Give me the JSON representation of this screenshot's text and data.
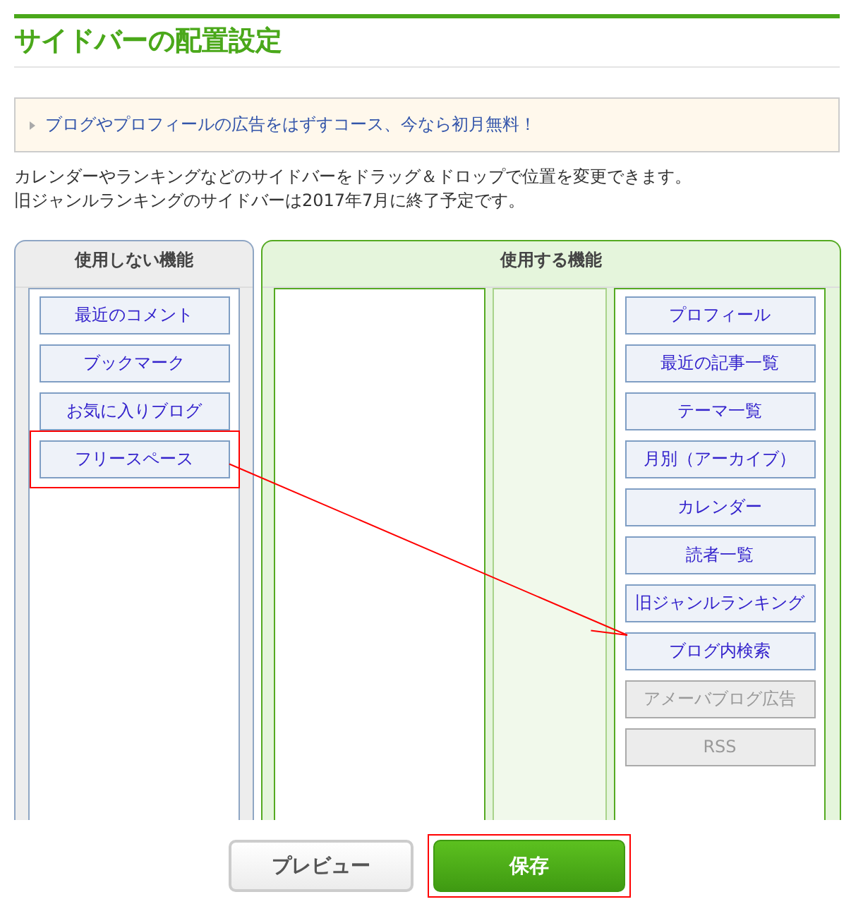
{
  "title": "サイドバーの配置設定",
  "notice": {
    "text": "ブログやプロフィールの広告をはずすコース、今なら初月無料！"
  },
  "description": [
    "カレンダーやランキングなどのサイドバーをドラッグ＆ドロップで位置を変更できます。",
    "旧ジャンルランキングのサイドバーは2017年7月に終了予定です。"
  ],
  "unused": {
    "heading": "使用しない機能",
    "items": [
      {
        "label": "最近のコメント",
        "disabled": false,
        "highlighted": false
      },
      {
        "label": "ブックマーク",
        "disabled": false,
        "highlighted": false
      },
      {
        "label": "お気に入りブログ",
        "disabled": false,
        "highlighted": false
      },
      {
        "label": "フリースペース",
        "disabled": false,
        "highlighted": true
      }
    ]
  },
  "used": {
    "heading": "使用する機能",
    "items": [
      {
        "label": "プロフィール",
        "disabled": false,
        "drop_target": false
      },
      {
        "label": "最近の記事一覧",
        "disabled": false,
        "drop_target": false
      },
      {
        "label": "テーマ一覧",
        "disabled": false,
        "drop_target": false
      },
      {
        "label": "月別（アーカイブ）",
        "disabled": false,
        "drop_target": false
      },
      {
        "label": "カレンダー",
        "disabled": false,
        "drop_target": false
      },
      {
        "label": "読者一覧",
        "disabled": false,
        "drop_target": false
      },
      {
        "label": "旧ジャンルランキング",
        "disabled": false,
        "drop_target": false
      },
      {
        "label": "ブログ内検索",
        "disabled": false,
        "drop_target": true
      },
      {
        "label": "アメーバブログ広告",
        "disabled": true,
        "drop_target": false
      },
      {
        "label": "RSS",
        "disabled": true,
        "drop_target": false
      }
    ]
  },
  "buttons": [
    {
      "kind": "secondary",
      "label": "プレビュー",
      "highlighted": false
    },
    {
      "kind": "primary",
      "label": "保存",
      "highlighted": true
    }
  ]
}
